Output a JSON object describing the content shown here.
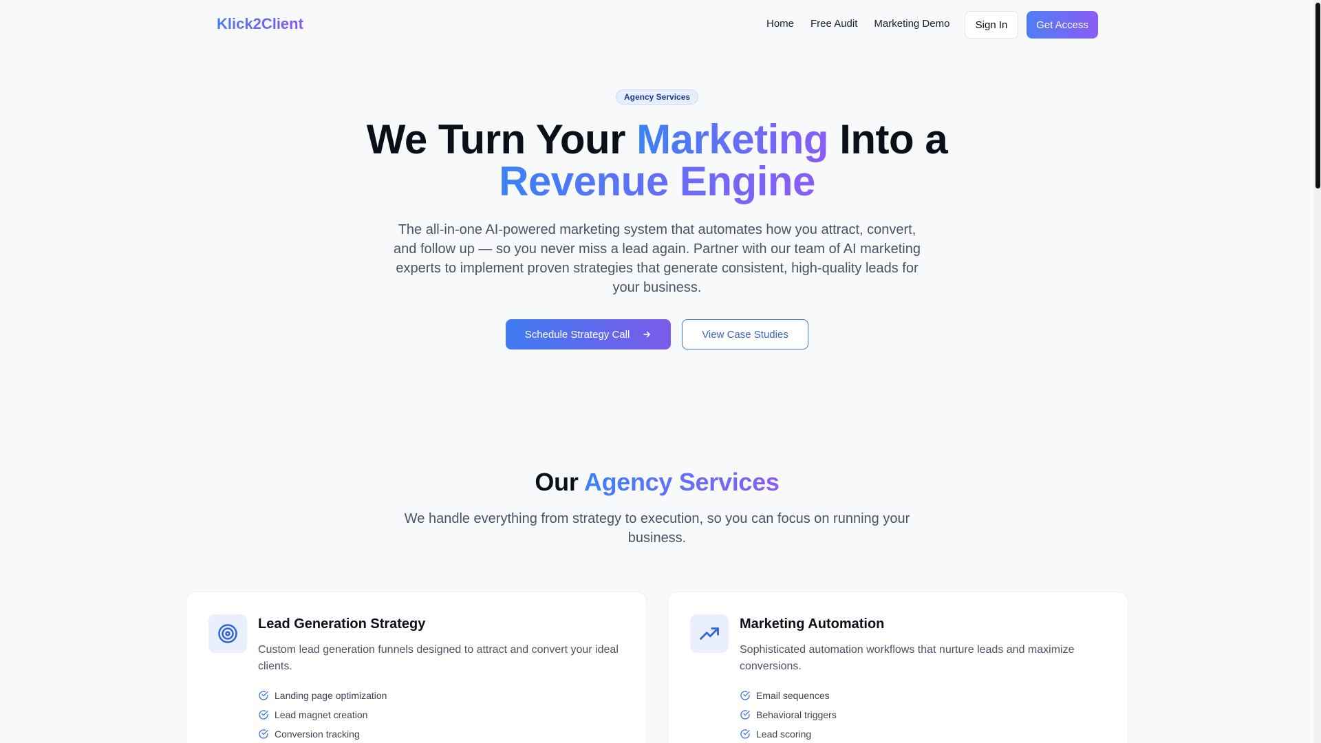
{
  "brand": {
    "name": "Klick2Client",
    "accent": "#3b82f6",
    "accent_secondary": "#8b5cf6"
  },
  "nav": {
    "links": [
      "Home",
      "Free Audit",
      "Marketing Demo"
    ],
    "sign_in": "Sign In",
    "get_access": "Get Access"
  },
  "hero": {
    "badge": "Agency Services",
    "title_part1": "We Turn Your ",
    "title_highlight1": "Marketing",
    "title_part2": " Into a",
    "title_highlight2": "Revenue Engine",
    "subtitle": "The all-in-one AI-powered marketing system that automates how you attract, convert, and follow up — so you never miss a lead again. Partner with our team of AI marketing experts to implement proven strategies that generate consistent, high-quality leads for your business.",
    "primary_cta": "Schedule Strategy Call",
    "primary_cta_icon": "arrow-right-icon",
    "secondary_cta": "View Case Studies"
  },
  "services": {
    "title_plain": "Our ",
    "title_highlight": "Agency Services",
    "subtitle": "We handle everything from strategy to execution, so you can focus on running your business.",
    "cards": [
      {
        "icon": "target-icon",
        "title": "Lead Generation Strategy",
        "description": "Custom lead generation funnels designed to attract and convert your ideal clients.",
        "features": [
          "Landing page optimization",
          "Lead magnet creation",
          "Conversion tracking"
        ]
      },
      {
        "icon": "trending-up-icon",
        "title": "Marketing Automation",
        "description": "Sophisticated automation workflows that nurture leads and maximize conversions.",
        "features": [
          "Email sequences",
          "Behavioral triggers",
          "Lead scoring"
        ]
      }
    ]
  }
}
